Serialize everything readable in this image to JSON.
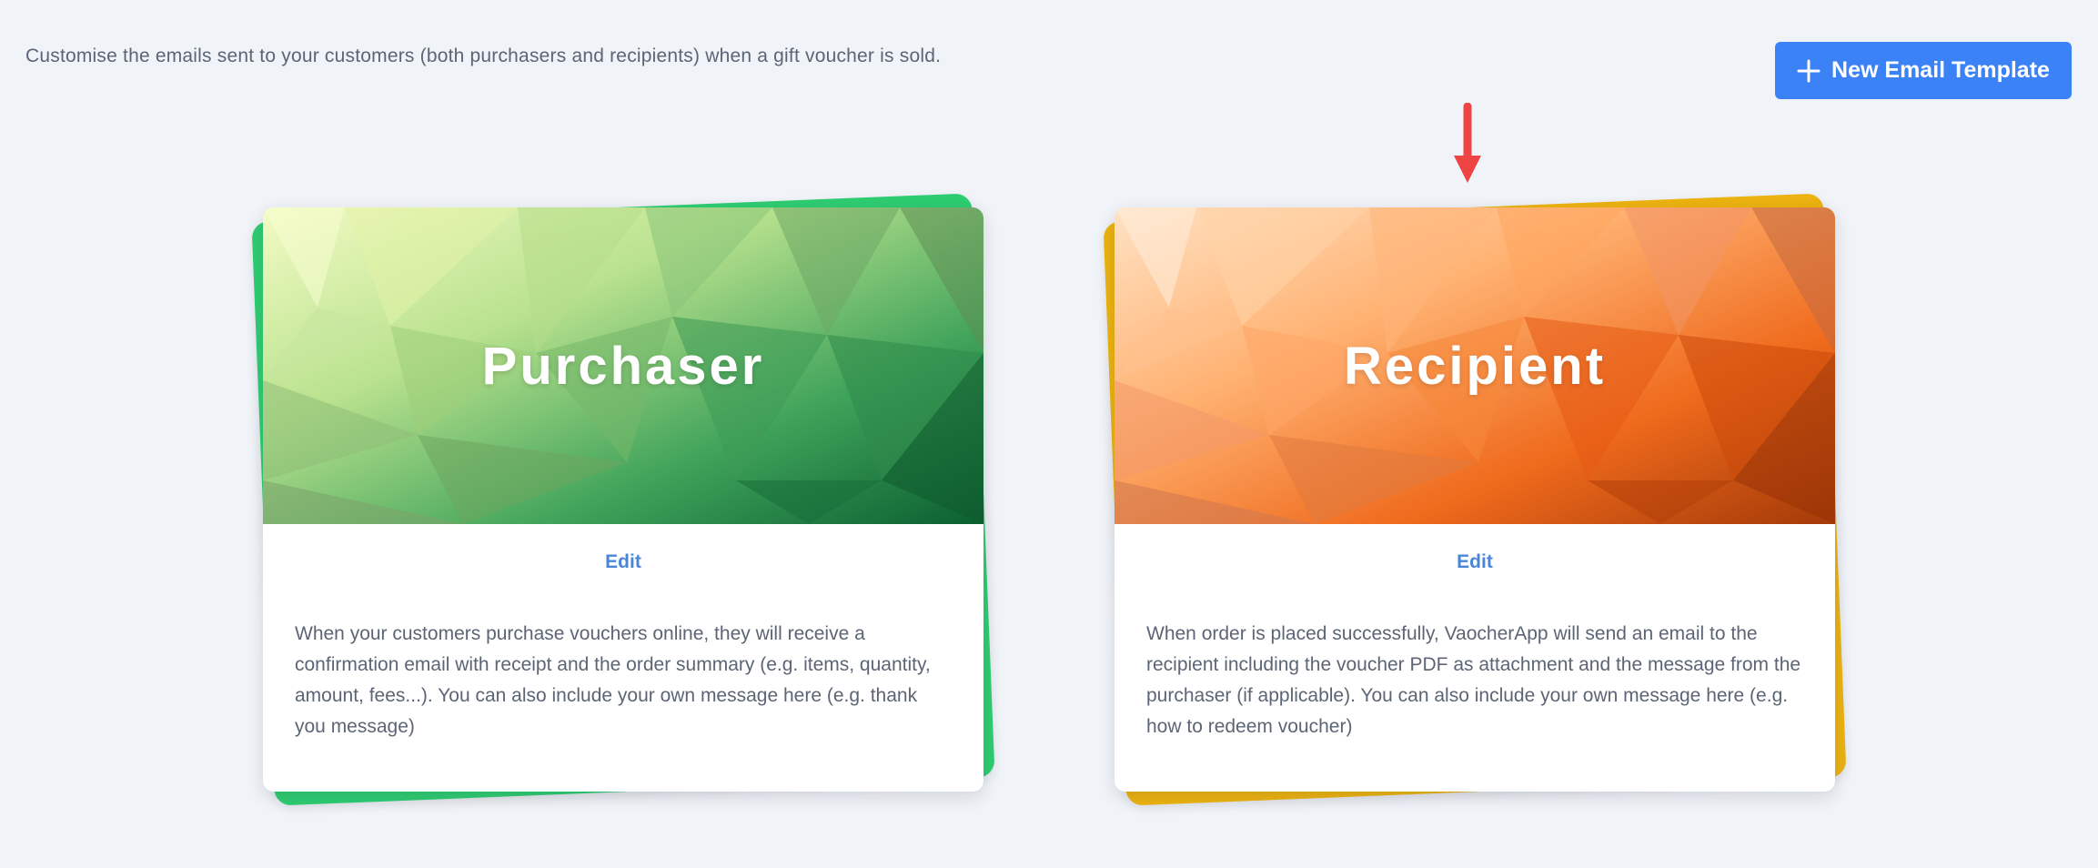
{
  "intro_text": "Customise the emails sent to your customers (both purchasers and recipients) when a gift voucher is sold.",
  "new_template_button": {
    "label": "New Email Template",
    "icon": "plus-icon"
  },
  "colors": {
    "accent": "#3b82f6",
    "link": "#4a86d8",
    "purchaser_card": "#2ecc71",
    "recipient_card": "#ecb210",
    "arrow": "#ef4444"
  },
  "cards": [
    {
      "title": "Purchaser",
      "edit_label": "Edit",
      "description": "When your customers purchase vouchers online, they will receive a confirmation email with receipt and the order summary (e.g. items, quantity, amount, fees...). You can also include your own message here (e.g. thank you message)"
    },
    {
      "title": "Recipient",
      "edit_label": "Edit",
      "description": "When order is placed successfully, VaocherApp will send an email to the recipient including the voucher PDF as attachment and the message from the purchaser (if applicable). You can also include your own message here (e.g. how to redeem voucher)"
    }
  ]
}
